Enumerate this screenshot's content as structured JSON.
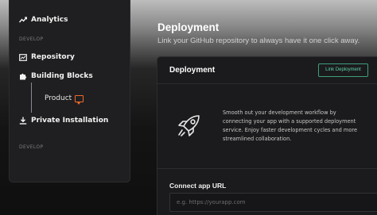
{
  "sidebar": {
    "items": [
      {
        "label": "Analytics",
        "icon": "trend-line-icon"
      },
      {
        "label": "Repository",
        "icon": "repository-icon"
      },
      {
        "label": "Building Blocks",
        "icon": "puzzle-icon"
      },
      {
        "label": "Private Installation",
        "icon": "download-icon"
      }
    ],
    "section_labels": [
      "DEVELOP",
      "DEVELOP"
    ],
    "sub_item": {
      "label": "Product",
      "icon": "chat-bubble-icon"
    }
  },
  "header": {
    "title": "Deployment",
    "subtitle": "Link your GitHub repository to always have it one click away."
  },
  "card": {
    "title": "Deployment",
    "link_button": "Link Deployment",
    "description": "Smooth out your development workflow by connecting your app with a supported deployment service. Enjoy faster development cycles and more streamlined collaboration.",
    "url_label": "Connect app URL",
    "url_placeholder": "e.g. https://yourapp.com",
    "illustration_icon": "rocket-icon"
  },
  "colors": {
    "accent_green": "#5fd1a6",
    "accent_orange": "#ee6a2a",
    "panel": "#1b1b1d",
    "sidebar": "#1f1f21"
  }
}
